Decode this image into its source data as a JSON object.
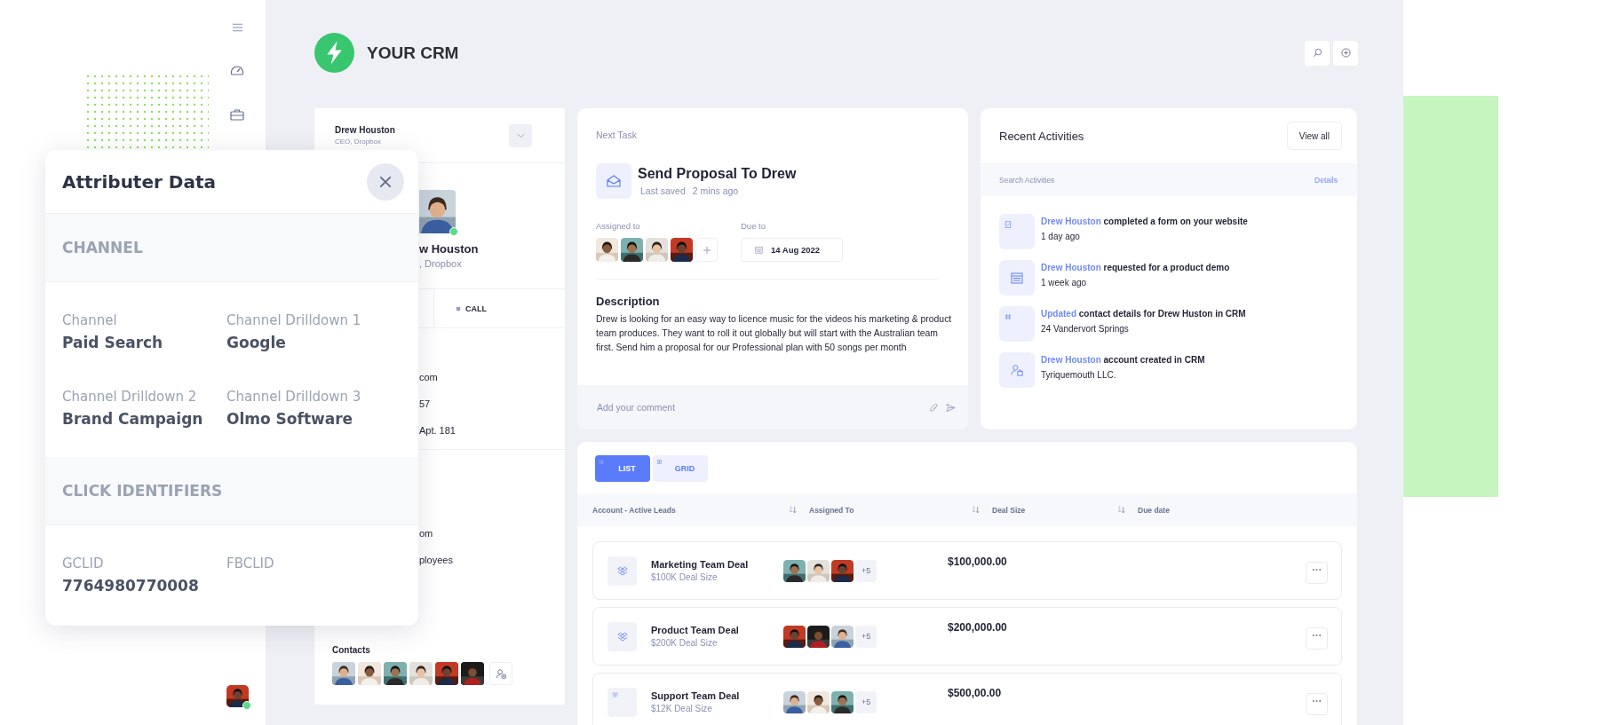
{
  "sidebar": {
    "user": {
      "kind": "picture",
      "online": true
    }
  },
  "header": {
    "title": "YOUR CRM"
  },
  "contact_card": {
    "name": "Drew Houston",
    "role": "CEO, Dropbox",
    "profile": {
      "kind": "picture",
      "online": true
    },
    "profile_name": "w Houston",
    "profile_role": ", Dropbox",
    "action": "CALL",
    "details": [
      "com",
      "57",
      "Apt. 181"
    ],
    "company_details": [
      "om",
      "ployees"
    ],
    "contacts_label": "Contacts",
    "contacts": [
      {
        "kind": "picture"
      },
      {
        "kind": "picture"
      },
      {
        "kind": "picture"
      },
      {
        "kind": "picture"
      },
      {
        "kind": "picture"
      },
      {
        "kind": "picture"
      }
    ]
  },
  "task": {
    "label": "Next Task",
    "title": "Send Proposal To Drew",
    "saved_label": "Last saved",
    "saved_time": "2 mins ago",
    "assigned_label": "Assigned to",
    "assignees": [
      {
        "kind": "picture"
      },
      {
        "kind": "picture"
      },
      {
        "kind": "picture"
      },
      {
        "kind": "picture"
      }
    ],
    "due_label": "Due to",
    "due_date": "14 Aug 2022",
    "description_title": "Description",
    "description": "Drew is looking for an easy way to licence music for the videos his marketing & product team produces. They want to roll it out globally but will start with the Australian team first. Send him a proposal for our Professional plan with 50 songs per month",
    "comment": {
      "placeholder": "Add your comment"
    }
  },
  "activities": {
    "title": "Recent Activities",
    "view_all": "View all",
    "search": {
      "placeholder": "Search Activities"
    },
    "details": "Details",
    "items": [
      {
        "kind": "form",
        "actor": "Drew Houston",
        "text": "completed a form on your website",
        "sub": "1 day ago"
      },
      {
        "kind": "calendar",
        "actor": "Drew Houston",
        "text": "requested for a product demo",
        "sub": "1 week ago"
      },
      {
        "kind": "update",
        "actor": "Updated",
        "text": "contact details for Drew Huston in CRM",
        "sub": "24 Vandervort Springs"
      },
      {
        "kind": "account",
        "actor": "Drew Houston",
        "text": "account created in CRM",
        "sub": "Tyriquemouth LLC."
      }
    ]
  },
  "leads": {
    "tabs": [
      {
        "label": "LIST",
        "kind": "list",
        "selected": true
      },
      {
        "label": "GRID",
        "kind": "grid",
        "selected": false
      }
    ],
    "columns": [
      "Account - Active Leads",
      "Assigned To",
      "Deal Size",
      "Due date"
    ],
    "rows": [
      {
        "name": "Marketing Team Deal",
        "sub": "$100K Deal Size",
        "assignees": [
          {
            "kind": "picture"
          },
          {
            "kind": "picture"
          },
          {
            "kind": "picture"
          }
        ],
        "extra": "+5",
        "amount": "$100,000.00"
      },
      {
        "name": "Product Team Deal",
        "sub": "$200K Deal Size",
        "assignees": [
          {
            "kind": "picture"
          },
          {
            "kind": "picture"
          },
          {
            "kind": "picture"
          }
        ],
        "extra": "+5",
        "amount": "$200,000.00"
      },
      {
        "name": "Support Team Deal",
        "sub": "$12K Deal Size",
        "assignees": [
          {
            "kind": "picture"
          },
          {
            "kind": "picture"
          },
          {
            "kind": "picture"
          }
        ],
        "extra": "+5",
        "amount": "$500,00.00"
      }
    ]
  },
  "popup": {
    "title": "Attributer Data",
    "sections": [
      {
        "heading": "CHANNEL",
        "fields": [
          {
            "label": "Channel",
            "value": "Paid Search"
          },
          {
            "label": "Channel Drilldown 1",
            "value": "Google"
          },
          {
            "label": "Channel Drilldown 2",
            "value": "Brand Campaign"
          },
          {
            "label": "Channel Drilldown 3",
            "value": "Olmo Software"
          }
        ]
      },
      {
        "heading": "CLICK IDENTIFIERS",
        "fields": [
          {
            "label": "GCLID",
            "value": "7764980770008"
          },
          {
            "label": "FBCLID"
          }
        ]
      }
    ]
  }
}
